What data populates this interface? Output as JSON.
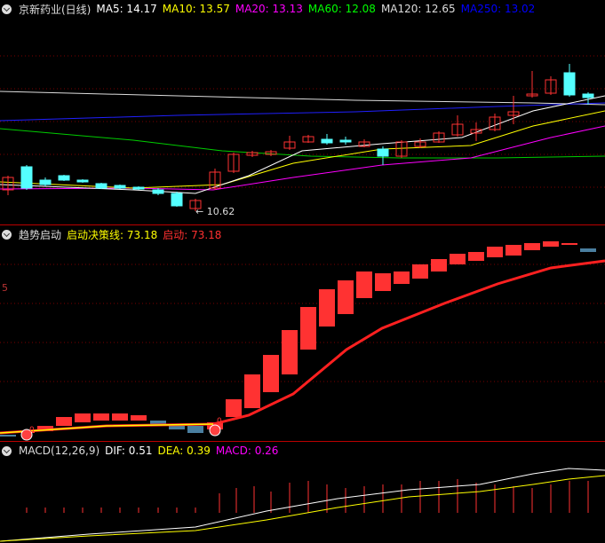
{
  "header1": {
    "title": "京新药业(日线)",
    "items": [
      {
        "label": "MA5: 14.17",
        "color": "#ffffff"
      },
      {
        "label": "MA10: 13.57",
        "color": "#ffff00"
      },
      {
        "label": "MA20: 13.13",
        "color": "#ff00ff"
      },
      {
        "label": "MA60: 12.08",
        "color": "#00ff00"
      },
      {
        "label": "MA120: 12.65",
        "color": "#dddddd"
      },
      {
        "label": "MA250: 13.02",
        "color": "#0000ff"
      }
    ]
  },
  "price_low_label": "10.62",
  "header2": {
    "title": "趋势启动",
    "items": [
      {
        "label": "启动决策线: 73.18",
        "color": "#ffff00"
      },
      {
        "label": "启动: 73.18",
        "color": "#ff3030"
      }
    ]
  },
  "axis2_label": "5",
  "markers": [
    "0",
    "0"
  ],
  "header3": {
    "title": "MACD(12,26,9)",
    "items": [
      {
        "label": "DIF: 0.51",
        "color": "#ffffff"
      },
      {
        "label": "DEA: 0.39",
        "color": "#ffff00"
      },
      {
        "label": "MACD: 0.26",
        "color": "#ff00ff"
      }
    ]
  },
  "colors": {
    "up": "#ff3232",
    "down": "#54ffff",
    "bg": "#000000",
    "grid": "#7a0000"
  }
}
